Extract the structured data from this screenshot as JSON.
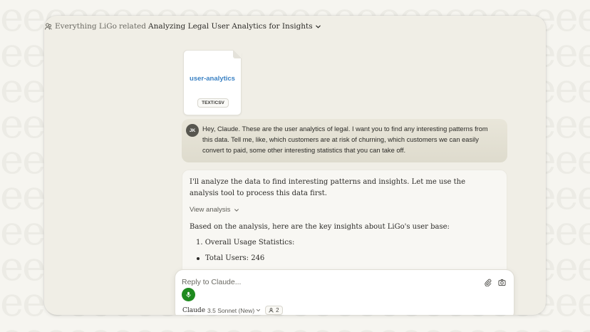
{
  "topbar": {
    "project": "Everything LiGo",
    "separator": "related",
    "chat_title": "Analyzing Legal User Analytics for Insights"
  },
  "attachment": {
    "file_name": "user-analytics",
    "file_type": "TEXT/CSV"
  },
  "user_message": {
    "avatar_initials": "JK",
    "text": "Hey, Claude. These are the user analytics of legal. I want you to find any interesting patterns from this data. Tell me, like, which customers are at risk of churning, which customers we can easily convert to paid, some other interesting statistics that you can take off."
  },
  "assistant_message": {
    "intro": "I'll analyze the data to find interesting patterns and insights. Let me use the analysis tool to process this data first.",
    "view_analysis_label": "View analysis",
    "summary_intro": "Based on the analysis, here are the key insights about LiGo's user base:",
    "list_item_1": "1. Overall Usage Statistics:",
    "bullet_1": "Total Users: 246"
  },
  "composer": {
    "placeholder": "Reply to Claude...",
    "model_name": "Claude",
    "model_version": "3.5 Sonnet (New)",
    "people_count": "2"
  },
  "colors": {
    "mic_button": "#1e8a1e",
    "file_name": "#3b82c4",
    "user_bubble": "#e4e1d4"
  }
}
